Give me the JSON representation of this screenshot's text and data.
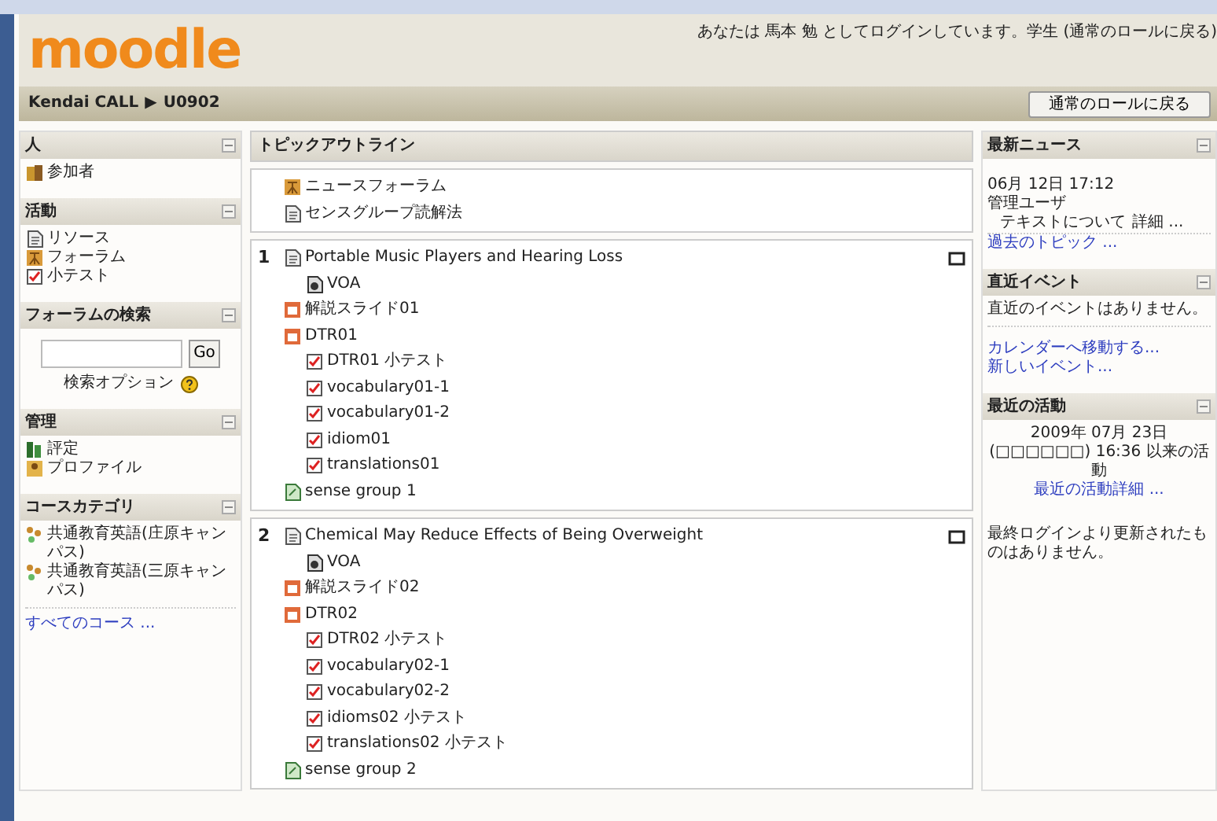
{
  "header": {
    "logo": "moodle",
    "login": {
      "prefix": "あなたは",
      "user": "馬本 勉",
      "suffix": "としてログインしています。学生",
      "role_link": "(通常のロールに戻る)"
    }
  },
  "navbar": {
    "breadcrumb": [
      "Kendai CALL",
      "U0902"
    ],
    "separator": "▶",
    "button": "通常のロールに戻る"
  },
  "left_blocks": [
    {
      "kind": "list",
      "title": "人",
      "items": [
        {
          "label": "参加者",
          "kind": "participants"
        }
      ]
    },
    {
      "kind": "list",
      "title": "活動",
      "items": [
        {
          "label": "リソース",
          "kind": "resource"
        },
        {
          "label": "フォーラム",
          "kind": "forum"
        },
        {
          "label": "小テスト",
          "kind": "quiz"
        }
      ]
    },
    {
      "kind": "search",
      "title": "フォーラムの検索",
      "button": "Go",
      "link": "検索オプション"
    },
    {
      "kind": "list",
      "title": "管理",
      "items": [
        {
          "label": "評定",
          "kind": "grades"
        },
        {
          "label": "プロファイル",
          "kind": "profile"
        }
      ]
    },
    {
      "kind": "list",
      "title": "コースカテゴリ",
      "items": [
        {
          "label": "共通教育英語(庄原キャンパス)",
          "kind": "category"
        },
        {
          "label": "共通教育英語(三原キャンパス)",
          "kind": "category"
        }
      ],
      "footer": "すべてのコース ..."
    }
  ],
  "center": {
    "title": "トピックアウトライン",
    "sections": [
      {
        "items": [
          {
            "label": "ニュースフォーラム",
            "kind": "forum"
          },
          {
            "label": "センスグループ読解法",
            "kind": "resource"
          }
        ]
      },
      {
        "number": "1",
        "items": [
          {
            "label": "Portable Music Players and Hearing Loss",
            "kind": "resource",
            "children": [
              {
                "label": "VOA",
                "kind": "audio"
              }
            ]
          },
          {
            "label": "解説スライド01",
            "kind": "slides"
          },
          {
            "label": "DTR01",
            "kind": "slides",
            "children": [
              {
                "label": "DTR01 小テスト",
                "kind": "quiz"
              },
              {
                "label": "vocabulary01-1",
                "kind": "quiz"
              },
              {
                "label": "vocabulary01-2",
                "kind": "quiz"
              },
              {
                "label": "idiom01",
                "kind": "quiz"
              },
              {
                "label": "translations01",
                "kind": "quiz"
              }
            ]
          },
          {
            "label": "sense group 1",
            "kind": "link"
          }
        ]
      },
      {
        "number": "2",
        "items": [
          {
            "label": "Chemical May Reduce Effects of Being Overweight",
            "kind": "resource",
            "children": [
              {
                "label": "VOA",
                "kind": "audio"
              }
            ]
          },
          {
            "label": "解説スライド02",
            "kind": "slides"
          },
          {
            "label": "DTR02",
            "kind": "slides",
            "children": [
              {
                "label": "DTR02 小テスト",
                "kind": "quiz"
              },
              {
                "label": "vocabulary02-1",
                "kind": "quiz"
              },
              {
                "label": "vocabulary02-2",
                "kind": "quiz"
              },
              {
                "label": "idioms02 小テスト",
                "kind": "quiz"
              },
              {
                "label": "translations02 小テスト",
                "kind": "quiz"
              }
            ]
          },
          {
            "label": "sense group 2",
            "kind": "link"
          }
        ]
      }
    ]
  },
  "right_blocks": [
    {
      "kind": "news",
      "title": "最新ニュース",
      "date": "06月 12日 17:12",
      "author": "管理ユーザ",
      "subject": "テキストについて",
      "more": "詳細 ...",
      "older": "過去のトピック ..."
    },
    {
      "kind": "events",
      "title": "直近イベント",
      "message": "直近のイベントはありません。",
      "links": [
        "カレンダーへ移動する...",
        "新しいイベント..."
      ]
    },
    {
      "kind": "recent",
      "title": "最近の活動",
      "since": "2009年 07月 23日 (□□□□□□) 16:36 以来の活動",
      "link": "最近の活動詳細 ...",
      "message": "最終ログインより更新されたものはありません。"
    }
  ]
}
